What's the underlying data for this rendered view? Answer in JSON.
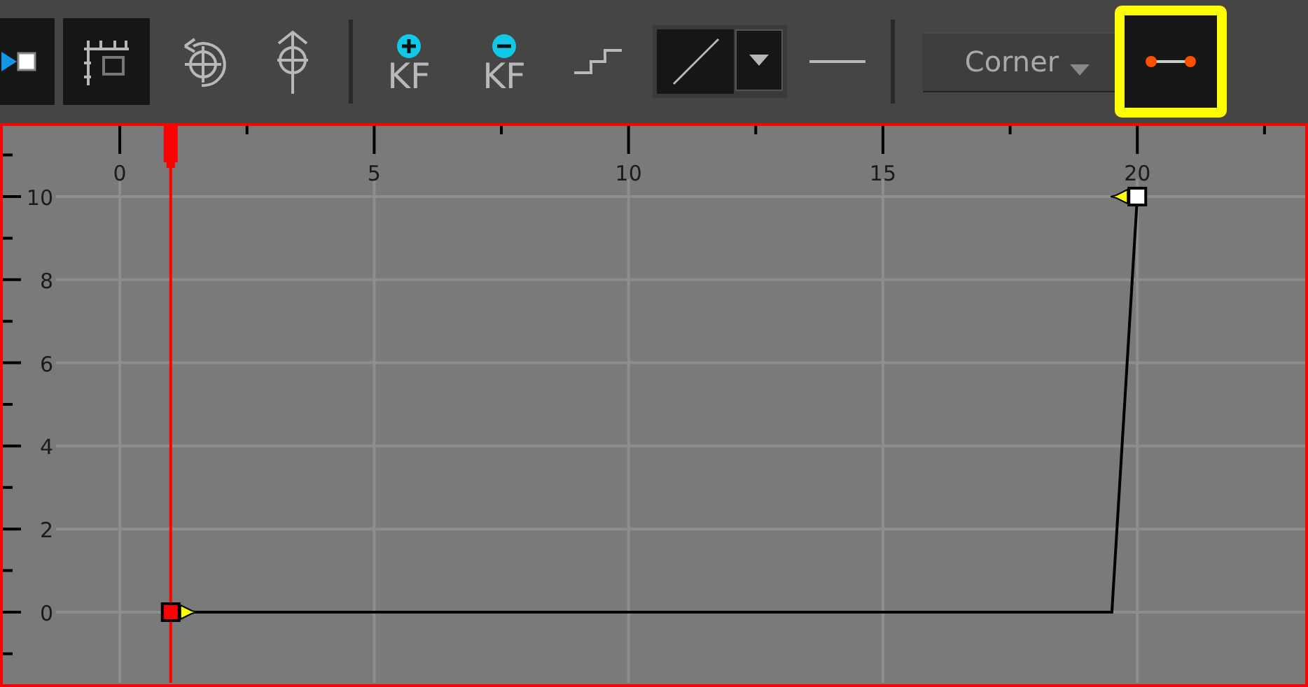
{
  "toolbar": {
    "items": [
      {
        "kind": "key-mode",
        "selected": true
      },
      {
        "kind": "snap",
        "selected": true
      },
      {
        "kind": "orbit",
        "selected": false
      },
      {
        "kind": "pivot",
        "selected": false
      },
      {
        "kind": "separator"
      },
      {
        "kind": "add-key",
        "label": "KF",
        "selected": false
      },
      {
        "kind": "remove-key",
        "label": "KF",
        "selected": false
      },
      {
        "kind": "step",
        "selected": false
      },
      {
        "kind": "linear",
        "selected": true
      },
      {
        "kind": "flat",
        "selected": false
      },
      {
        "kind": "separator"
      },
      {
        "kind": "dropdown",
        "value": "Corner"
      },
      {
        "kind": "link",
        "selected": true,
        "highlighted": true
      }
    ]
  },
  "graph": {
    "chart_data": {
      "type": "line",
      "x": [
        1,
        19.5,
        20
      ],
      "series": [
        {
          "color": "#000000",
          "values": [
            0,
            0,
            10
          ]
        }
      ],
      "grid": true,
      "xlim": [
        -2.3,
        23.3
      ],
      "ylim": [
        -1.7,
        11.7
      ],
      "xticks": [
        0,
        5,
        10,
        15,
        20
      ],
      "yticks": [
        0,
        2,
        4,
        6,
        8,
        10
      ],
      "ref_lines": [
        {
          "axis": "x",
          "value": 1,
          "color": "#ff0000"
        }
      ]
    },
    "keyframes": [
      {
        "selected": true
      },
      {
        "selected": false
      }
    ]
  }
}
